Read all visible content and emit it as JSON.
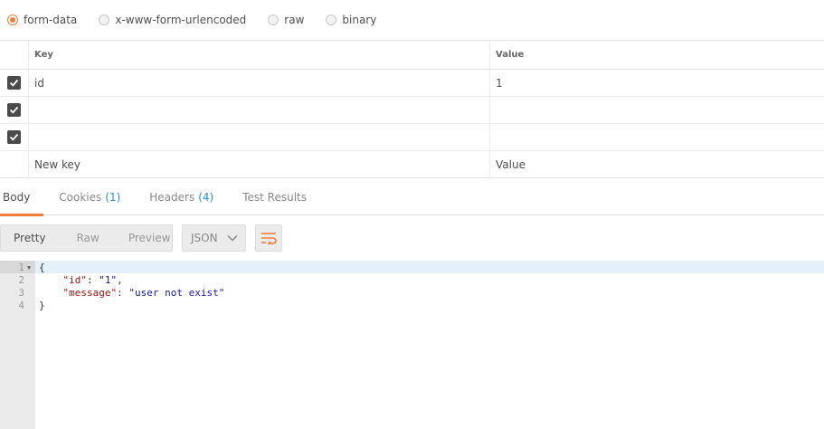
{
  "body_types": [
    {
      "label": "form-data",
      "selected": true
    },
    {
      "label": "x-www-form-urlencoded",
      "selected": false
    },
    {
      "label": "raw",
      "selected": false
    },
    {
      "label": "binary",
      "selected": false
    }
  ],
  "params_table": {
    "headers": {
      "key": "Key",
      "value": "Value"
    },
    "rows": [
      {
        "key": "id",
        "value": "1",
        "checked": true
      },
      {
        "key": "",
        "value": "",
        "checked": true
      },
      {
        "key": "",
        "value": "",
        "checked": true
      }
    ],
    "new_row": {
      "key_placeholder": "New key",
      "value_placeholder": "Value"
    }
  },
  "response_tabs": [
    {
      "label": "Body",
      "count": "",
      "active": true
    },
    {
      "label": "Cookies",
      "count": "(1)",
      "active": false
    },
    {
      "label": "Headers",
      "count": "(4)",
      "active": false
    },
    {
      "label": "Test Results",
      "count": "",
      "active": false
    }
  ],
  "view_modes": [
    {
      "label": "Pretty",
      "active": true
    },
    {
      "label": "Raw",
      "active": false
    },
    {
      "label": "Preview",
      "active": false
    }
  ],
  "format": {
    "selected": "JSON",
    "icon": "chevron-down-icon"
  },
  "wrap_icon": "wrap-lines-icon",
  "colors": {
    "accent": "#f07c3a",
    "count": "#2d8fd8",
    "json_key": "#a31515",
    "json_string": "#1a1aa6"
  },
  "response_body": {
    "lines": [
      {
        "n": "1",
        "fold": true
      },
      {
        "n": "2",
        "key": "\"id\"",
        "value": "\"1\"",
        "trail": ","
      },
      {
        "n": "3",
        "key": "\"message\"",
        "value": "\"user not exist\"",
        "trail": ""
      },
      {
        "n": "4"
      }
    ],
    "open_brace": "{",
    "close_brace": "}"
  }
}
